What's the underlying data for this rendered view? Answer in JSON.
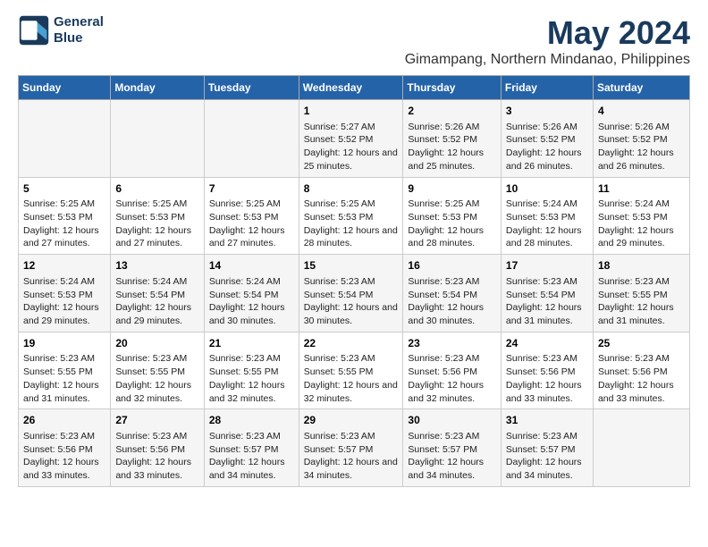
{
  "logo": {
    "line1": "General",
    "line2": "Blue"
  },
  "title": "May 2024",
  "subtitle": "Gimampang, Northern Mindanao, Philippines",
  "days_header": [
    "Sunday",
    "Monday",
    "Tuesday",
    "Wednesday",
    "Thursday",
    "Friday",
    "Saturday"
  ],
  "weeks": [
    [
      {
        "day": "",
        "info": ""
      },
      {
        "day": "",
        "info": ""
      },
      {
        "day": "",
        "info": ""
      },
      {
        "day": "1",
        "info": "Sunrise: 5:27 AM\nSunset: 5:52 PM\nDaylight: 12 hours and 25 minutes."
      },
      {
        "day": "2",
        "info": "Sunrise: 5:26 AM\nSunset: 5:52 PM\nDaylight: 12 hours and 25 minutes."
      },
      {
        "day": "3",
        "info": "Sunrise: 5:26 AM\nSunset: 5:52 PM\nDaylight: 12 hours and 26 minutes."
      },
      {
        "day": "4",
        "info": "Sunrise: 5:26 AM\nSunset: 5:52 PM\nDaylight: 12 hours and 26 minutes."
      }
    ],
    [
      {
        "day": "5",
        "info": "Sunrise: 5:25 AM\nSunset: 5:53 PM\nDaylight: 12 hours and 27 minutes."
      },
      {
        "day": "6",
        "info": "Sunrise: 5:25 AM\nSunset: 5:53 PM\nDaylight: 12 hours and 27 minutes."
      },
      {
        "day": "7",
        "info": "Sunrise: 5:25 AM\nSunset: 5:53 PM\nDaylight: 12 hours and 27 minutes."
      },
      {
        "day": "8",
        "info": "Sunrise: 5:25 AM\nSunset: 5:53 PM\nDaylight: 12 hours and 28 minutes."
      },
      {
        "day": "9",
        "info": "Sunrise: 5:25 AM\nSunset: 5:53 PM\nDaylight: 12 hours and 28 minutes."
      },
      {
        "day": "10",
        "info": "Sunrise: 5:24 AM\nSunset: 5:53 PM\nDaylight: 12 hours and 28 minutes."
      },
      {
        "day": "11",
        "info": "Sunrise: 5:24 AM\nSunset: 5:53 PM\nDaylight: 12 hours and 29 minutes."
      }
    ],
    [
      {
        "day": "12",
        "info": "Sunrise: 5:24 AM\nSunset: 5:53 PM\nDaylight: 12 hours and 29 minutes."
      },
      {
        "day": "13",
        "info": "Sunrise: 5:24 AM\nSunset: 5:54 PM\nDaylight: 12 hours and 29 minutes."
      },
      {
        "day": "14",
        "info": "Sunrise: 5:24 AM\nSunset: 5:54 PM\nDaylight: 12 hours and 30 minutes."
      },
      {
        "day": "15",
        "info": "Sunrise: 5:23 AM\nSunset: 5:54 PM\nDaylight: 12 hours and 30 minutes."
      },
      {
        "day": "16",
        "info": "Sunrise: 5:23 AM\nSunset: 5:54 PM\nDaylight: 12 hours and 30 minutes."
      },
      {
        "day": "17",
        "info": "Sunrise: 5:23 AM\nSunset: 5:54 PM\nDaylight: 12 hours and 31 minutes."
      },
      {
        "day": "18",
        "info": "Sunrise: 5:23 AM\nSunset: 5:55 PM\nDaylight: 12 hours and 31 minutes."
      }
    ],
    [
      {
        "day": "19",
        "info": "Sunrise: 5:23 AM\nSunset: 5:55 PM\nDaylight: 12 hours and 31 minutes."
      },
      {
        "day": "20",
        "info": "Sunrise: 5:23 AM\nSunset: 5:55 PM\nDaylight: 12 hours and 32 minutes."
      },
      {
        "day": "21",
        "info": "Sunrise: 5:23 AM\nSunset: 5:55 PM\nDaylight: 12 hours and 32 minutes."
      },
      {
        "day": "22",
        "info": "Sunrise: 5:23 AM\nSunset: 5:55 PM\nDaylight: 12 hours and 32 minutes."
      },
      {
        "day": "23",
        "info": "Sunrise: 5:23 AM\nSunset: 5:56 PM\nDaylight: 12 hours and 32 minutes."
      },
      {
        "day": "24",
        "info": "Sunrise: 5:23 AM\nSunset: 5:56 PM\nDaylight: 12 hours and 33 minutes."
      },
      {
        "day": "25",
        "info": "Sunrise: 5:23 AM\nSunset: 5:56 PM\nDaylight: 12 hours and 33 minutes."
      }
    ],
    [
      {
        "day": "26",
        "info": "Sunrise: 5:23 AM\nSunset: 5:56 PM\nDaylight: 12 hours and 33 minutes."
      },
      {
        "day": "27",
        "info": "Sunrise: 5:23 AM\nSunset: 5:56 PM\nDaylight: 12 hours and 33 minutes."
      },
      {
        "day": "28",
        "info": "Sunrise: 5:23 AM\nSunset: 5:57 PM\nDaylight: 12 hours and 34 minutes."
      },
      {
        "day": "29",
        "info": "Sunrise: 5:23 AM\nSunset: 5:57 PM\nDaylight: 12 hours and 34 minutes."
      },
      {
        "day": "30",
        "info": "Sunrise: 5:23 AM\nSunset: 5:57 PM\nDaylight: 12 hours and 34 minutes."
      },
      {
        "day": "31",
        "info": "Sunrise: 5:23 AM\nSunset: 5:57 PM\nDaylight: 12 hours and 34 minutes."
      },
      {
        "day": "",
        "info": ""
      }
    ]
  ]
}
